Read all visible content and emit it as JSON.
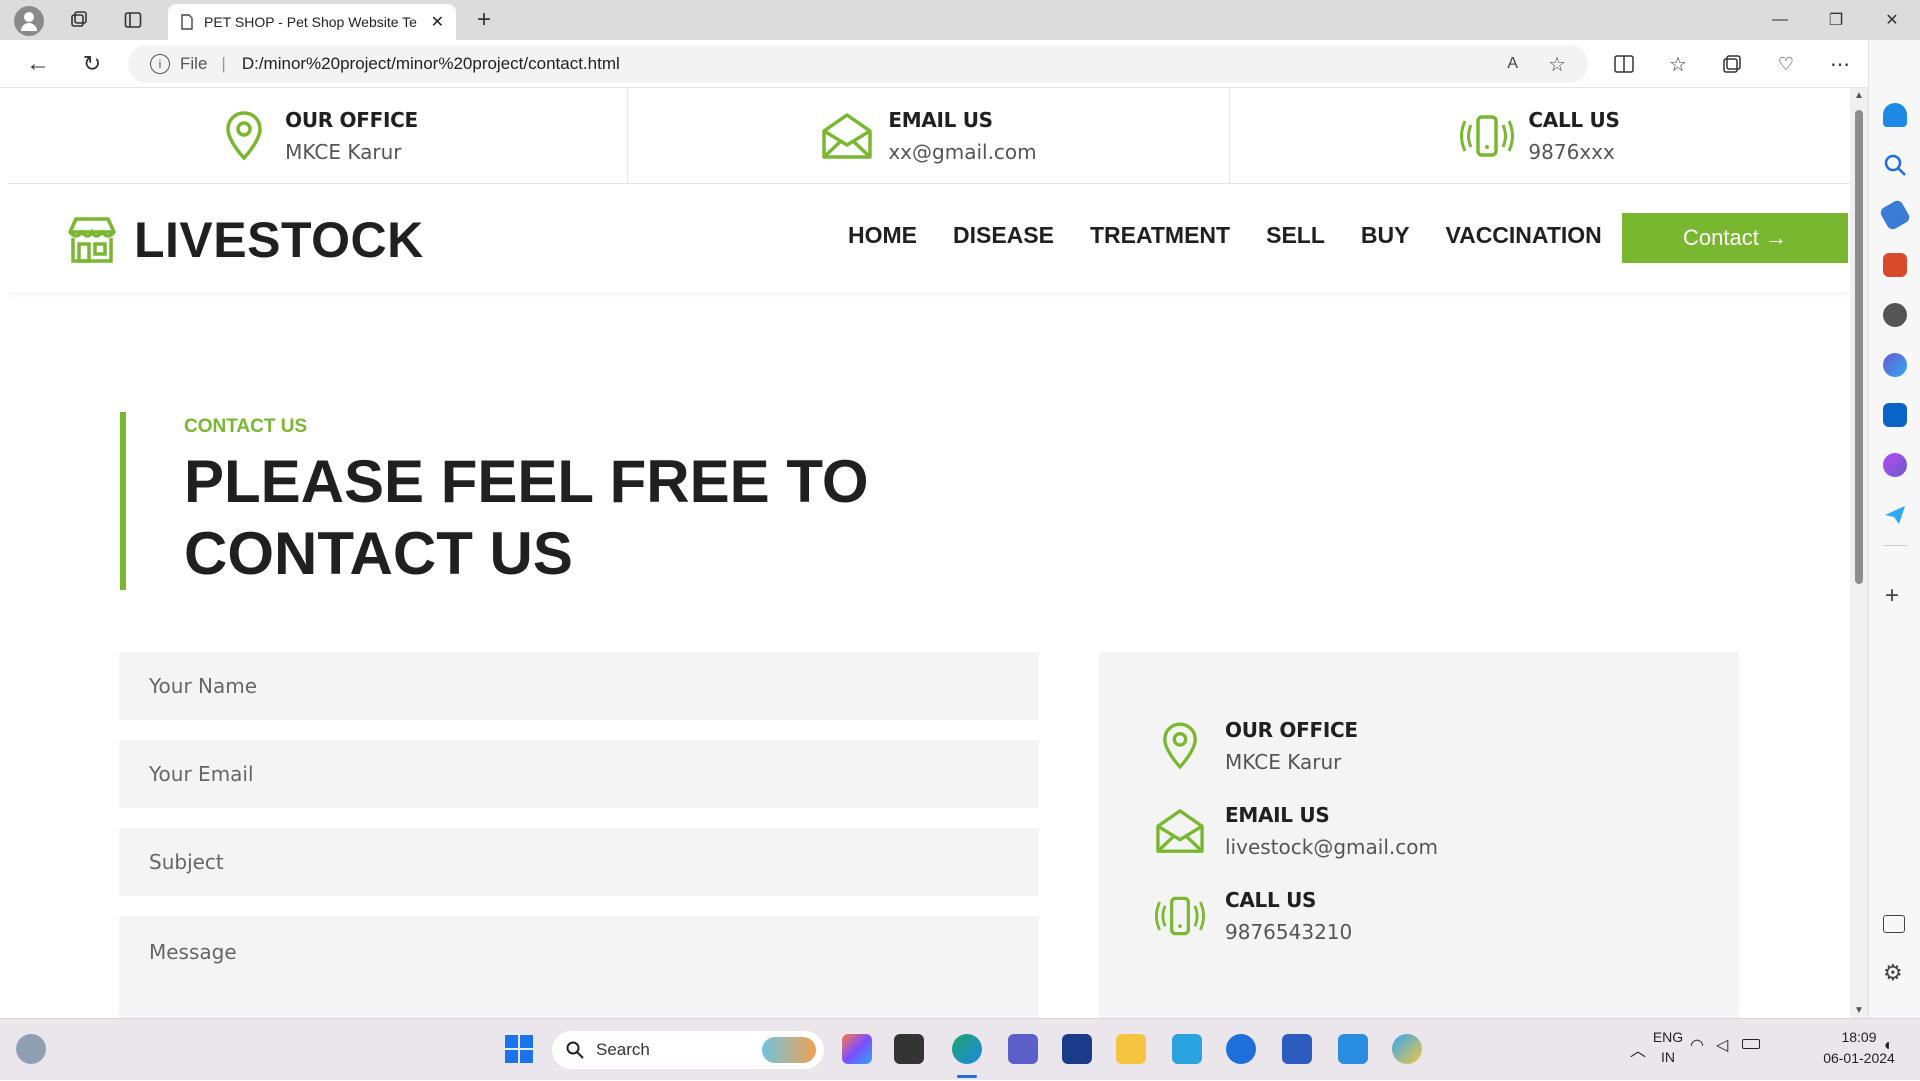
{
  "browser": {
    "tab_title": "PET SHOP - Pet Shop Website Te",
    "url_label": "File",
    "url": "D:/minor%20project/minor%20project/contact.html"
  },
  "topbar": {
    "office": {
      "title": "OUR OFFICE",
      "text": "MKCE Karur"
    },
    "email": {
      "title": "EMAIL US",
      "text": "xx@gmail.com"
    },
    "call": {
      "title": "CALL US",
      "text": "9876xxx"
    }
  },
  "navbar": {
    "brand": "LIVESTOCK",
    "menu": [
      "HOME",
      "DISEASE",
      "TREATMENT",
      "SELL",
      "BUY",
      "VACCINATION"
    ],
    "contact_button": "Contact →"
  },
  "contact": {
    "eyebrow": "CONTACT US",
    "heading_line1": "PLEASE FEEL FREE TO",
    "heading_line2": "CONTACT US"
  },
  "form": {
    "name_placeholder": "Your Name",
    "email_placeholder": "Your Email",
    "subject_placeholder": "Subject",
    "message_placeholder": "Message"
  },
  "infobox": {
    "office": {
      "title": "OUR OFFICE",
      "text": "MKCE Karur"
    },
    "email": {
      "title": "EMAIL US",
      "text": "livestock@gmail.com"
    },
    "call": {
      "title": "CALL US",
      "text": "9876543210"
    }
  },
  "taskbar": {
    "search_label": "Search",
    "lang_top": "ENG",
    "lang_bottom": "IN",
    "time": "18:09",
    "date": "06-01-2024"
  },
  "colors": {
    "accent": "#7ab730",
    "dark": "#202020",
    "panel": "#f4f4f4"
  }
}
